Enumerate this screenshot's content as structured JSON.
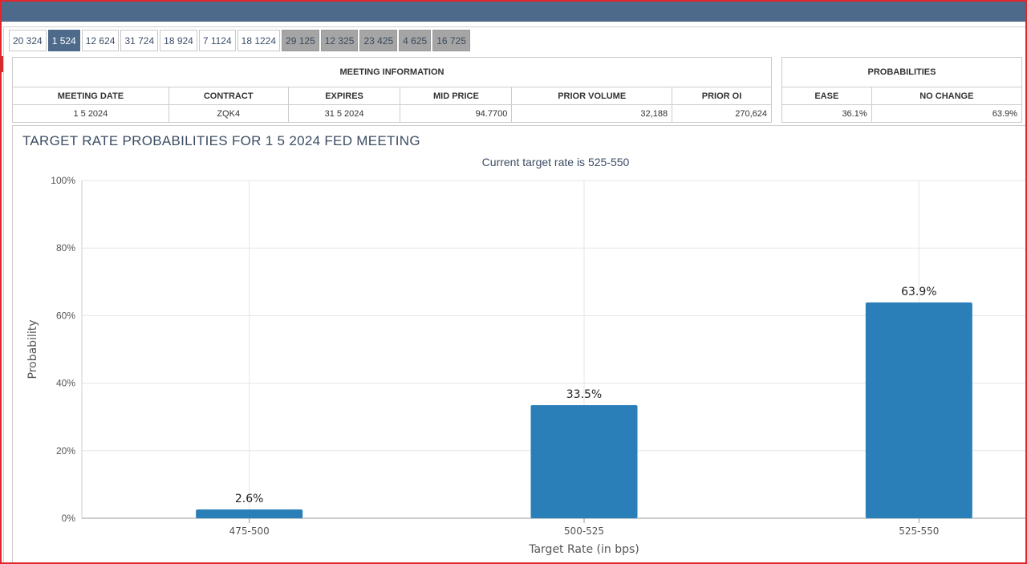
{
  "tabs": [
    {
      "label": "20 324",
      "state": "normal"
    },
    {
      "label": "1 524",
      "state": "active"
    },
    {
      "label": "12 624",
      "state": "normal"
    },
    {
      "label": "31 724",
      "state": "normal"
    },
    {
      "label": "18 924",
      "state": "normal"
    },
    {
      "label": "7 1124",
      "state": "normal"
    },
    {
      "label": "18 1224",
      "state": "normal"
    },
    {
      "label": "29 125",
      "state": "future"
    },
    {
      "label": "12 325",
      "state": "future"
    },
    {
      "label": "23 425",
      "state": "future"
    },
    {
      "label": "4 625",
      "state": "future"
    },
    {
      "label": "16 725",
      "state": "future"
    }
  ],
  "meeting_info": {
    "title": "MEETING INFORMATION",
    "headers": {
      "meeting_date": "MEETING DATE",
      "contract": "CONTRACT",
      "expires": "EXPIRES",
      "mid_price": "MID PRICE",
      "prior_volume": "PRIOR VOLUME",
      "prior_oi": "PRIOR OI"
    },
    "values": {
      "meeting_date": "1 5 2024",
      "contract": "ZQK4",
      "expires": "31 5 2024",
      "mid_price": "94.7700",
      "prior_volume": "32,188",
      "prior_oi": "270,624"
    }
  },
  "probabilities": {
    "title": "PROBABILITIES",
    "headers": {
      "ease": "EASE",
      "no_change": "NO CHANGE"
    },
    "values": {
      "ease": "36.1%",
      "no_change": "63.9%"
    }
  },
  "chart_data": {
    "type": "bar",
    "title": "TARGET RATE PROBABILITIES FOR 1 5 2024 FED MEETING",
    "subtitle": "Current target rate is 525-550",
    "xlabel": "Target Rate (in bps)",
    "ylabel": "Probability",
    "categories": [
      "475-500",
      "500-525",
      "525-550"
    ],
    "values": [
      2.6,
      33.5,
      63.9
    ],
    "data_labels": [
      "2.6%",
      "33.5%",
      "63.9%"
    ],
    "ylim": [
      0,
      100
    ],
    "yticks": [
      0,
      20,
      40,
      60,
      80,
      100
    ],
    "ytick_labels": [
      "0%",
      "20%",
      "40%",
      "60%",
      "80%",
      "100%"
    ],
    "grid": true,
    "bar_color": "#2a7fb8"
  },
  "colors": {
    "topbar": "#4e6a8b",
    "active_tab": "#4e6a8b",
    "future_tab": "#a5a5a5",
    "frame": "#e0262a"
  }
}
